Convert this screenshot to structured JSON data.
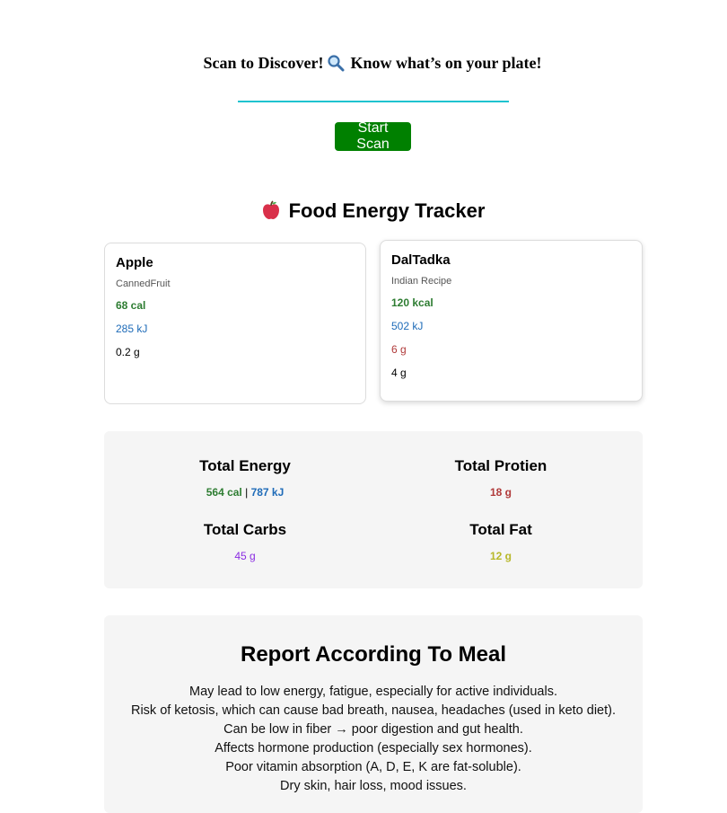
{
  "scan": {
    "title_before": "Scan to Discover!",
    "title_after": "Know what’s on your plate!",
    "icon": "magnifying-glass-icon",
    "button_label": "Start Scan",
    "button_color": "#008000",
    "line_color": "#1fc3cf"
  },
  "tracker": {
    "title": "Food Energy Tracker",
    "icon": "apple-icon"
  },
  "cards": [
    {
      "name": "Apple",
      "category": "CannedFruit",
      "calories": "68 cal",
      "energy_kj": "285 kJ",
      "value": "0.2 g"
    },
    {
      "name": "DalTadka",
      "category": "Indian Recipe",
      "calories": "120 kcal",
      "energy_kj": "502 kJ",
      "protein": "6 g",
      "value": "4 g"
    }
  ],
  "totals": {
    "energy_label": "Total Energy",
    "energy_cal": "564 cal",
    "energy_sep": "|",
    "energy_kj": "787 kJ",
    "protein_label": "Total Protien",
    "protein_value": "18 g",
    "carbs_label": "Total Carbs",
    "carbs_value": "45 g",
    "fat_label": "Total Fat",
    "fat_value": "12 g"
  },
  "report": {
    "title": "Report According To Meal",
    "lines": [
      "May lead to low energy, fatigue, especially for active individuals.",
      "Risk of ketosis, which can cause bad breath, nausea, headaches (used in keto diet).",
      "Can be low in fiber → poor digestion and gut health.",
      "Affects hormone production (especially sex hormones).",
      "Poor vitamin absorption (A, D, E, K are fat-soluble).",
      "Dry skin, hair loss, mood issues."
    ]
  },
  "colors": {
    "calories": "#2e7d32",
    "kj": "#1e6bb8",
    "protein": "#b03a3a",
    "carbs": "#8a2be2",
    "fat": "#b8b82a",
    "panel_bg": "#f5f5f5"
  }
}
